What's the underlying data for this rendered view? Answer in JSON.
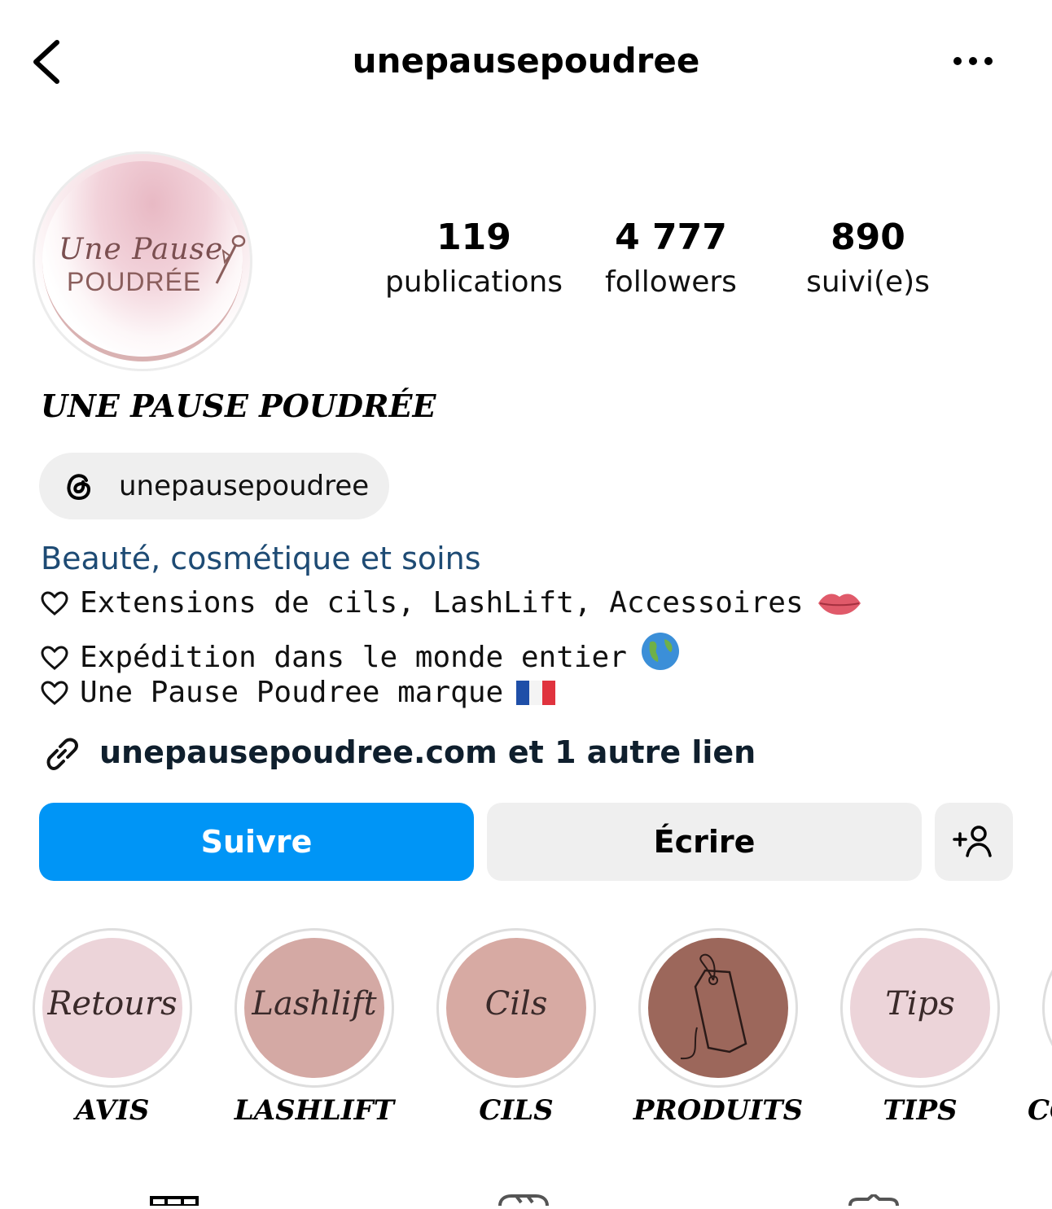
{
  "header": {
    "username": "unepausepoudree"
  },
  "avatar": {
    "script_text": "Une Pause",
    "caps_text": "POUDRÉE"
  },
  "stats": [
    {
      "value": "119",
      "label": "publications"
    },
    {
      "value": "4 777",
      "label": "followers"
    },
    {
      "value": "890",
      "label": "suivi(e)s"
    }
  ],
  "profile": {
    "display_name": "UNE PAUSE POUDRÉE",
    "threads_handle": "unepausepoudree",
    "category": "Beauté, cosmétique et soins",
    "bio_lines": [
      {
        "text": "Extensions de cils, LashLift, Accessoires",
        "emoji": "lips-emoji"
      },
      {
        "text": "Expédition dans le monde entier",
        "emoji": "globe-emoji"
      },
      {
        "text": "Une Pause Poudree marque",
        "emoji": "france-flag-emoji"
      }
    ],
    "link_text": "unepausepoudree.com et 1 autre lien"
  },
  "actions": {
    "follow_label": "Suivre",
    "message_label": "Écrire",
    "add_person_icon": "add-person-icon"
  },
  "highlights": [
    {
      "cover_text": "Retours",
      "label": "AVIS",
      "color": "#ecd4d9"
    },
    {
      "cover_text": "Lashlift",
      "label": "LASHLIFT",
      "color": "#d4a9a4"
    },
    {
      "cover_text": "Cils",
      "label": "CILS",
      "color": "#d7aaa3"
    },
    {
      "cover_text": "",
      "label": "PRODUITS",
      "color": "#9c675b"
    },
    {
      "cover_text": "Tips",
      "label": "TIPS",
      "color": "#ecd4d9"
    },
    {
      "cover_text": "",
      "label": "CO",
      "color": "#ffffff"
    }
  ],
  "colors": {
    "accent": "#0095f6",
    "category": "#1e4b74",
    "button_gray": "#efefef"
  }
}
